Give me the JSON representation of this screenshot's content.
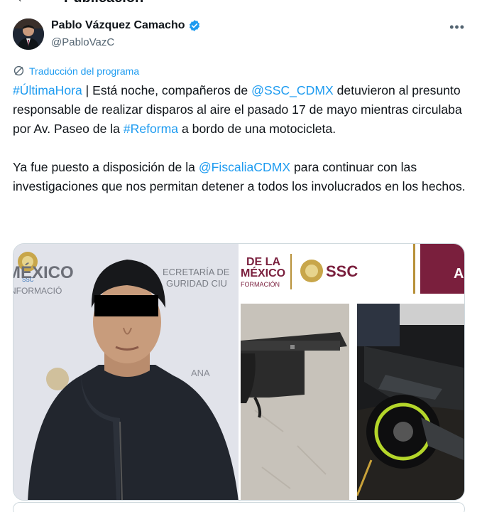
{
  "top": {
    "back_glyph": "←",
    "title": "Publicación"
  },
  "author": {
    "name": "Pablo Vázquez Camacho",
    "handle": "@PabloVazC",
    "verified_color": "#1d9bf0",
    "avatar_icon": "profile-photo"
  },
  "more_glyph": "•••",
  "translation": {
    "label": "Traducción del programa",
    "icon": "translate-globe-icon"
  },
  "tweet": {
    "p1": {
      "hashtag1": "#ÚltimaHora",
      "t1": " | Está noche, compañeros de ",
      "mention1": "@SSC_CDMX",
      "t2": " detuvieron al presunto responsable de realizar disparos al aire el pasado 17 de mayo mientras circulaba por Av. Paseo de la ",
      "hashtag2": "#Reforma",
      "t3": " a bordo de una motocicleta."
    },
    "p2": {
      "t1": "Ya fue puesto a disposición de la ",
      "mention1": "@FiscaliaCDMX",
      "t2": " para continuar con las investigaciones que nos permitan detener a todos los involucrados en los hechos."
    }
  },
  "media": {
    "left_text1": "MÉXICO",
    "left_text2": "ECRETARÍA DE",
    "left_text3": "GURIDAD CIU",
    "left_text4": "NFORMACIÓ",
    "left_text5": "ANA",
    "left_logo_text": "SSC",
    "right_text1": "DE LA",
    "right_text2": "MÉXICO",
    "right_text3": "FORMACIÓN",
    "right_ssc": "SSC",
    "right_edge": "A"
  },
  "colors": {
    "link": "#1d9bf0",
    "text": "#0f1419",
    "secondary": "#536471",
    "border": "#cfd9de",
    "maroon": "#7a1f3d",
    "gold": "#b8913a"
  }
}
